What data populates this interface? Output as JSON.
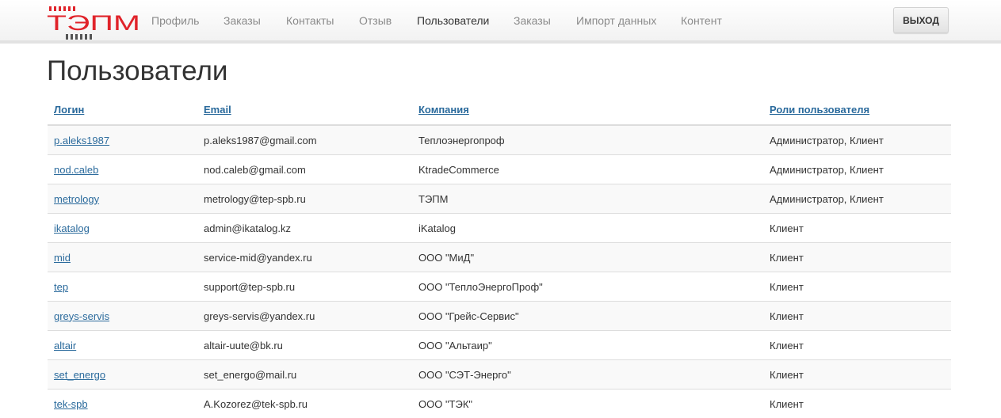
{
  "brand": {
    "logo_text": "ТЭПМ",
    "color": "#e0232a"
  },
  "nav": {
    "items": [
      {
        "label": "Профиль",
        "active": false
      },
      {
        "label": "Заказы",
        "active": false
      },
      {
        "label": "Контакты",
        "active": false
      },
      {
        "label": "Отзыв",
        "active": false
      },
      {
        "label": "Пользователи",
        "active": true
      },
      {
        "label": "Заказы",
        "active": false
      },
      {
        "label": "Импорт данных",
        "active": false
      },
      {
        "label": "Контент",
        "active": false
      }
    ],
    "logout_label": "ВЫХОД"
  },
  "page": {
    "title": "Пользователи"
  },
  "table": {
    "headers": [
      "Логин",
      "Email",
      "Компания",
      "Роли пользователя"
    ],
    "rows": [
      [
        "p.aleks1987",
        "p.aleks1987@gmail.com",
        "Теплоэнергопроф",
        "Администратор, Клиент"
      ],
      [
        "nod.caleb",
        "nod.caleb@gmail.com",
        "KtradeCommerce",
        "Администратор, Клиент"
      ],
      [
        "metrology",
        "metrology@tep-spb.ru",
        "ТЭПМ",
        "Администратор, Клиент"
      ],
      [
        "ikatalog",
        "admin@ikatalog.kz",
        "iKatalog",
        "Клиент"
      ],
      [
        "mid",
        "service-mid@yandex.ru",
        "ООО \"МиД\"",
        "Клиент"
      ],
      [
        "tep",
        "support@tep-spb.ru",
        "ООО \"ТеплоЭнергоПроф\"",
        "Клиент"
      ],
      [
        "greys-servis",
        "greys-servis@yandex.ru",
        "ООО \"Грейс-Сервис\"",
        "Клиент"
      ],
      [
        "altair",
        "altair-uute@bk.ru",
        "ООО \"Альтаир\"",
        "Клиент"
      ],
      [
        "set_energo",
        "set_energo@mail.ru",
        "ООО \"СЭТ-Энерго\"",
        "Клиент"
      ],
      [
        "tek-spb",
        "A.Kozorez@tek-spb.ru",
        "ООО \"ТЭК\"",
        "Клиент"
      ]
    ]
  }
}
